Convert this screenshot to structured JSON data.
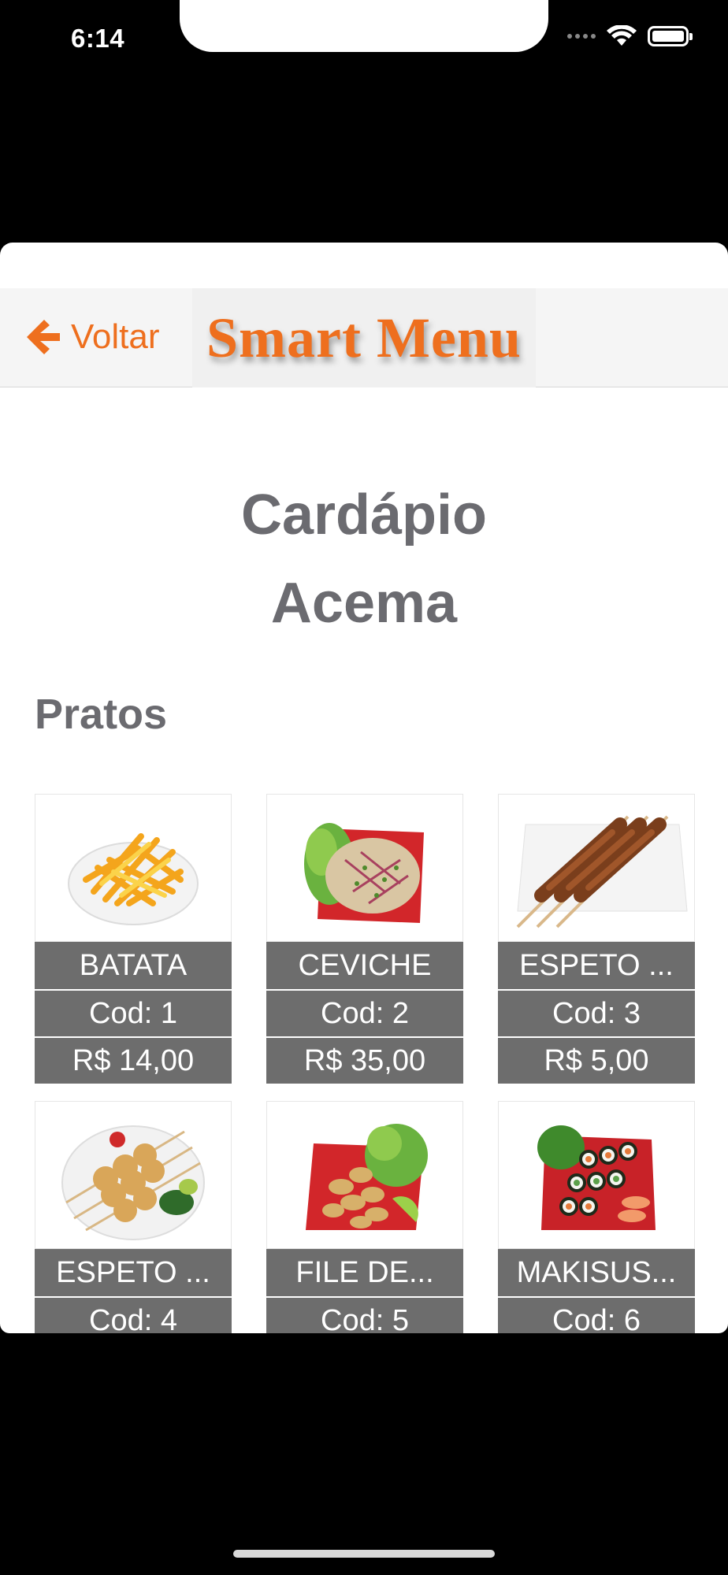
{
  "status": {
    "time": "6:14"
  },
  "navbar": {
    "back_label": "Voltar",
    "logo_text": "Smart Menu"
  },
  "page": {
    "title_line1": "Cardápio",
    "title_line2": "Acema",
    "section": "Pratos"
  },
  "items": [
    {
      "name": "BATATA",
      "code": "Cod:  1",
      "price": "R$  14,00",
      "image": "french-fries-image"
    },
    {
      "name": "CEVICHE",
      "code": "Cod:  2",
      "price": "R$  35,00",
      "image": "ceviche-image"
    },
    {
      "name": "ESPETO ...",
      "code": "Cod:  3",
      "price": "R$  5,00",
      "image": "skewer-image"
    },
    {
      "name": "ESPETO ...",
      "code": "Cod:  4",
      "price": "",
      "image": "chicken-skewer-image"
    },
    {
      "name": "FILE DE...",
      "code": "Cod:  5",
      "price": "",
      "image": "fried-fish-image"
    },
    {
      "name": "MAKISUS...",
      "code": "Cod:  6",
      "price": "",
      "image": "sushi-image"
    }
  ],
  "colors": {
    "accent": "#ee6f1e",
    "title_gray": "#6b6b70",
    "card_bar": "#6d6d6d"
  }
}
